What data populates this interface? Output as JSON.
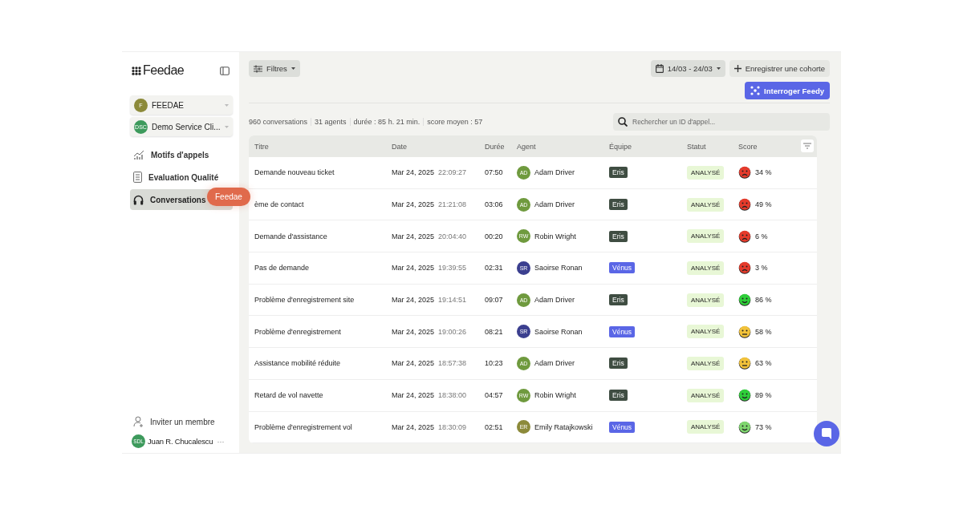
{
  "sidebar": {
    "logo": "Feedae",
    "workspaces": [
      {
        "label": "FEEDAE",
        "initials": "F",
        "color": "#8c8a3a"
      },
      {
        "label": "Demo Service Cli...",
        "initials": "DSC",
        "color": "#3d9a5c"
      }
    ],
    "items": [
      {
        "label": "Motifs d'appels",
        "selected": false
      },
      {
        "label": "Evaluation Qualité",
        "selected": false
      },
      {
        "label": "Conversations",
        "selected": true
      }
    ],
    "invite": "Inviter un membre",
    "user": {
      "initials": "SDL",
      "name": "Juan R. Chucalescu",
      "more": "···"
    }
  },
  "tooltip": "Feedae",
  "toolbar": {
    "filters": "Filtres",
    "date_range": "14/03 - 24/03",
    "save_cohort": "Enregistrer une cohorte",
    "ask": "Interroger Feedy"
  },
  "stats": [
    "960 conversations",
    "31 agents",
    "durée : 85 h. 21 min.",
    "score moyen : 57"
  ],
  "search": {
    "placeholder": "Rechercher un ID d'appel..."
  },
  "table": {
    "columns": [
      "Titre",
      "Date",
      "Durée",
      "Agent",
      "Équipe",
      "Statut",
      "Score"
    ],
    "rows": [
      {
        "title": "Demande nouveau ticket",
        "date": "Mar 24, 2025",
        "time": "22:09:27",
        "duration": "07:50",
        "agent": {
          "initials": "AD",
          "name": "Adam Driver",
          "color": "#6f9a3e"
        },
        "team": {
          "label": "Eris",
          "color": "#3f4d42"
        },
        "status": "ANALYSÉ",
        "score": {
          "text": "34 %",
          "kind": "angry",
          "color": "#e53b2c"
        },
        "faded": false
      },
      {
        "title": "ème de contact",
        "date": "Mar 24, 2025",
        "time": "21:21:08",
        "duration": "03:06",
        "agent": {
          "initials": "AD",
          "name": "Adam Driver",
          "color": "#6f9a3e"
        },
        "team": {
          "label": "Eris",
          "color": "#3f4d42"
        },
        "status": "ANALYSÉ",
        "score": {
          "text": "49 %",
          "kind": "angry",
          "color": "#e53b2c"
        },
        "faded": false
      },
      {
        "title": "Demande d'assistance",
        "date": "Mar 24, 2025",
        "time": "20:04:40",
        "duration": "00:20",
        "agent": {
          "initials": "RW",
          "name": "Robin Wright",
          "color": "#6f9a3e"
        },
        "team": {
          "label": "Eris",
          "color": "#3f4d42"
        },
        "status": "ANALYSÉ",
        "score": {
          "text": "6 %",
          "kind": "angry",
          "color": "#e53b2c"
        },
        "faded": false
      },
      {
        "title": "Pas de demande",
        "date": "Mar 24, 2025",
        "time": "19:39:55",
        "duration": "02:31",
        "agent": {
          "initials": "SR",
          "name": "Saoirse Ronan",
          "color": "#3b3f8f"
        },
        "team": {
          "label": "Vénus",
          "color": "#5a66e6"
        },
        "status": "ANALYSÉ",
        "score": {
          "text": "3 %",
          "kind": "angry",
          "color": "#e53b2c"
        },
        "faded": false
      },
      {
        "title": "Problème d'enregistrement site",
        "date": "Mar 24, 2025",
        "time": "19:14:51",
        "duration": "09:07",
        "agent": {
          "initials": "AD",
          "name": "Adam Driver",
          "color": "#6f9a3e"
        },
        "team": {
          "label": "Eris",
          "color": "#3f4d42"
        },
        "status": "ANALYSÉ",
        "score": {
          "text": "86 %",
          "kind": "happy",
          "color": "#2fcf3a"
        },
        "faded": false
      },
      {
        "title": "Problème d'enregistrement",
        "date": "Mar 24, 2025",
        "time": "19:00:26",
        "duration": "08:21",
        "agent": {
          "initials": "SR",
          "name": "Saoirse Ronan",
          "color": "#3b3f8f"
        },
        "team": {
          "label": "Vénus",
          "color": "#5a66e6"
        },
        "status": "ANALYSÉ",
        "score": {
          "text": "58 %",
          "kind": "neutral",
          "color": "#f2c23a"
        },
        "faded": false
      },
      {
        "title": "Assistance mobilité réduite",
        "date": "Mar 24, 2025",
        "time": "18:57:38",
        "duration": "10:23",
        "agent": {
          "initials": "AD",
          "name": "Adam Driver",
          "color": "#6f9a3e"
        },
        "team": {
          "label": "Eris",
          "color": "#3f4d42"
        },
        "status": "ANALYSÉ",
        "score": {
          "text": "63 %",
          "kind": "neutral",
          "color": "#f2c23a"
        },
        "faded": false
      },
      {
        "title": "Retard de vol navette",
        "date": "Mar 24, 2025",
        "time": "18:38:00",
        "duration": "04:57",
        "agent": {
          "initials": "RW",
          "name": "Robin Wright",
          "color": "#6f9a3e"
        },
        "team": {
          "label": "Eris",
          "color": "#3f4d42"
        },
        "status": "ANALYSÉ",
        "score": {
          "text": "89 %",
          "kind": "happy",
          "color": "#2fcf3a"
        },
        "faded": false
      },
      {
        "title": "Problème d'enregistrement vol",
        "date": "Mar 24, 2025",
        "time": "18:30:09",
        "duration": "02:51",
        "agent": {
          "initials": "ER",
          "name": "Emily Ratajkowski",
          "color": "#8c8a3a"
        },
        "team": {
          "label": "Vénus",
          "color": "#5a66e6"
        },
        "status": "ANALYSÉ",
        "score": {
          "text": "73 %",
          "kind": "happy",
          "color": "#7fd66f"
        },
        "faded": false
      }
    ]
  }
}
